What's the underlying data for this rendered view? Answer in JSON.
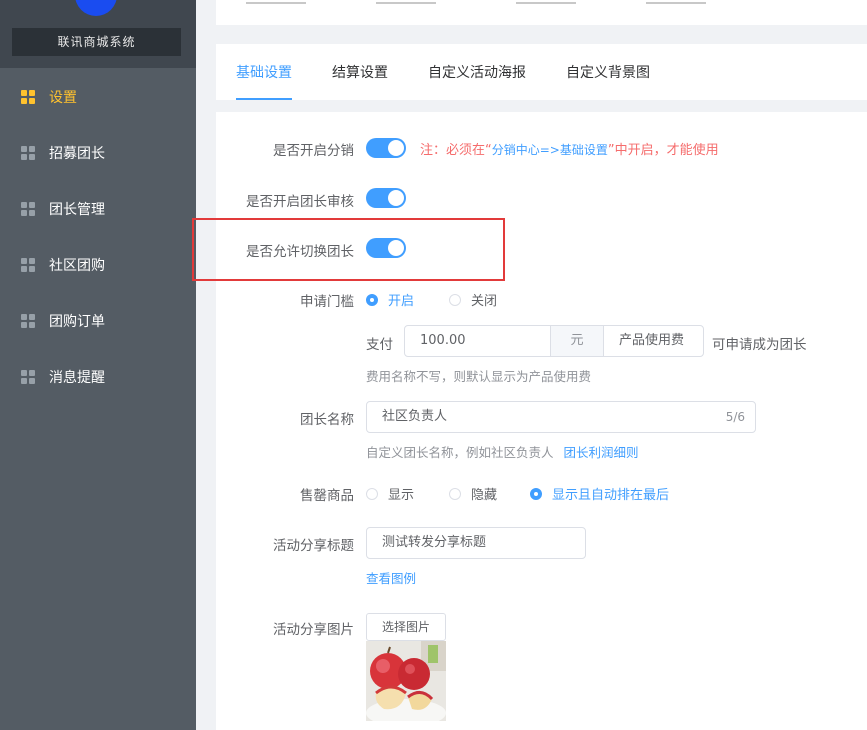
{
  "sidebar": {
    "store_name": "联讯商城系统",
    "items": [
      {
        "label": "设置",
        "active": true
      },
      {
        "label": "招募团长",
        "active": false
      },
      {
        "label": "团长管理",
        "active": false
      },
      {
        "label": "社区团购",
        "active": false
      },
      {
        "label": "团购订单",
        "active": false
      },
      {
        "label": "消息提醒",
        "active": false
      }
    ]
  },
  "tabs": [
    {
      "label": "基础设置",
      "active": true
    },
    {
      "label": "结算设置",
      "active": false
    },
    {
      "label": "自定义活动海报",
      "active": false
    },
    {
      "label": "自定义背景图",
      "active": false
    }
  ],
  "form": {
    "enable_distribution": {
      "label": "是否开启分销",
      "on": true,
      "note_prefix": "注：必须在“",
      "note_link": "分销中心=>基础设置",
      "note_suffix": "”中开启，才能使用"
    },
    "enable_leader_review": {
      "label": "是否开启团长审核",
      "on": true
    },
    "allow_switch_leader": {
      "label": "是否允许切换团长",
      "on": true
    },
    "apply_threshold": {
      "label": "申请门槛",
      "options": [
        "开启",
        "关闭"
      ],
      "selected": "开启",
      "pay_label": "支付",
      "amount": "100.00",
      "unit": "元",
      "fee_name": "产品使用费",
      "after_text": "可申请成为团长",
      "hint": "费用名称不写，则默认显示为产品使用费"
    },
    "leader_name": {
      "label": "团长名称",
      "value": "社区负责人",
      "count": "5/6",
      "hint": "自定义团长名称，例如社区负责人",
      "hint_link": "团长利润细则"
    },
    "sold_out": {
      "label": "售罄商品",
      "options": [
        "显示",
        "隐藏",
        "显示且自动排在最后"
      ],
      "selected": "显示且自动排在最后"
    },
    "share_title": {
      "label": "活动分享标题",
      "value": "测试转发分享标题",
      "link": "查看图例"
    },
    "share_image": {
      "label": "活动分享图片",
      "button": "选择图片"
    }
  },
  "colors": {
    "sidebar_bg": "#545c64",
    "active_menu": "#ffc22e",
    "primary": "#409eff",
    "warning": "#f56c6c",
    "highlight_border": "#e23a3a"
  }
}
